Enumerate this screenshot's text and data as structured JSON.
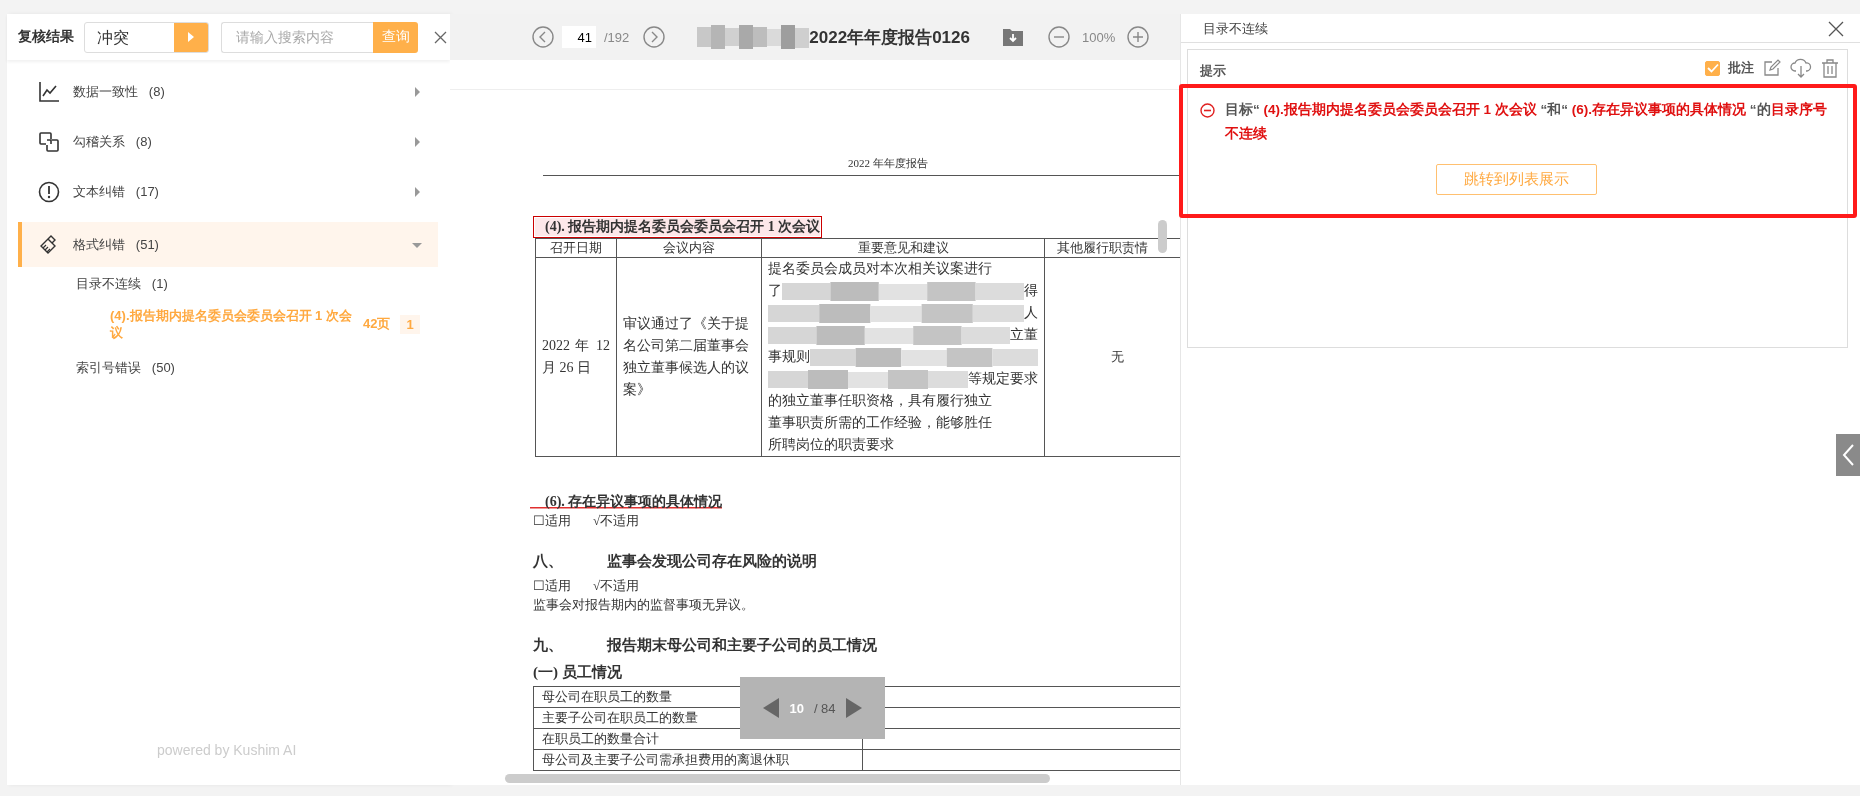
{
  "left_panel": {
    "title": "复核结果",
    "filter": {
      "value": "冲突"
    },
    "search": {
      "placeholder": "请输入搜索内容",
      "button": "查询"
    },
    "categories": [
      {
        "kind": "chart",
        "label": "数据一致性",
        "count": "(8)",
        "expanded": false,
        "selected": false
      },
      {
        "kind": "link",
        "label": "勾稽关系",
        "count": "(8)",
        "expanded": false,
        "selected": false
      },
      {
        "kind": "alert",
        "label": "文本纠错",
        "count": "(17)",
        "expanded": false,
        "selected": false
      },
      {
        "kind": "brush",
        "label": "格式纠错",
        "count": "(51)",
        "expanded": true,
        "selected": true,
        "children": [
          {
            "label": "目录不连续",
            "count": "(1)",
            "children": [
              {
                "label": "(4).报告期内提名委员会委员会召开 1 次会议",
                "page": "42页",
                "badge": "1",
                "selected": true
              }
            ]
          },
          {
            "label": "索引号错误",
            "count": "(50)"
          }
        ]
      }
    ],
    "footer": "powered by Kushim AI"
  },
  "viewer": {
    "page_input": "41",
    "page_total": "/192",
    "title": "2022年年度报告0126",
    "zoom": "100%",
    "page": {
      "header": "2022 年年度报告",
      "blocks": [
        {
          "kind": "heading",
          "text": "(4). 报告期内提名委员会委员会召开 1 次会议",
          "boxed": true,
          "struck": false
        },
        {
          "kind": "meeting_table",
          "columns": [
            "召开日期",
            "会议内容",
            "重要意见和建议",
            "其他履行职责情"
          ],
          "row": {
            "date": "2022 年 12 月 26 日",
            "content": "审议通过了《关于提名公司第二届董事会独立董事候选人的议案》",
            "other": "无",
            "advice": [
              {
                "text": "提名委员会成员对本次相关议案进行"
              },
              {
                "left": "了",
                "right": "得"
              },
              {
                "right": "人"
              },
              {
                "right": "立董"
              },
              {
                "left": "事规则"
              },
              {
                "right": "等规定要求"
              },
              {
                "text": "的独立董事任职资格，具有履行独立"
              },
              {
                "text": "董事职责所需的工作经验，能够胜任"
              },
              {
                "text": "所聘岗位的职责要求"
              }
            ]
          }
        },
        {
          "kind": "heading",
          "text": "(6). 存在异议事项的具体情况",
          "boxed": false,
          "struck": true
        },
        {
          "kind": "checks",
          "items": [
            "☐适用",
            "√不适用"
          ]
        },
        {
          "kind": "section",
          "number": "八、",
          "text": "监事会发现公司存在风险的说明"
        },
        {
          "kind": "checks",
          "items": [
            "☐适用",
            "√不适用"
          ]
        },
        {
          "kind": "paragraph",
          "text": "监事会对报告期内的监督事项无异议。"
        },
        {
          "kind": "section",
          "number": "九、",
          "text": "报告期末母公司和主要子公司的员工情况"
        },
        {
          "kind": "subheading",
          "text": "(一) 员工情况"
        },
        {
          "kind": "staff_table",
          "rows": [
            "母公司在职员工的数量",
            "主要子公司在职员工的数量",
            "在职员工的数量合计",
            "母公司及主要子公司需承担费用的离退休职"
          ]
        }
      ]
    },
    "page_indicator": {
      "current": "10",
      "total": "/ 84"
    }
  },
  "right_panel": {
    "title": "目录不连续",
    "section": "提示",
    "annotate": {
      "label": "批注",
      "checked": true
    },
    "card": {
      "selected": true,
      "message": [
        {
          "kind": "plain",
          "text": "目标“ "
        },
        {
          "kind": "target",
          "text": "(4).报告期内提名委员会委员会召开 1 次会议"
        },
        {
          "kind": "plain",
          "text": " “和“ "
        },
        {
          "kind": "target",
          "text": "(6).存在异议事项的具体情况"
        },
        {
          "kind": "plain",
          "text": " “的"
        },
        {
          "kind": "target",
          "text": "目录序号不连续"
        }
      ],
      "button": "跳转到列表展示"
    }
  }
}
